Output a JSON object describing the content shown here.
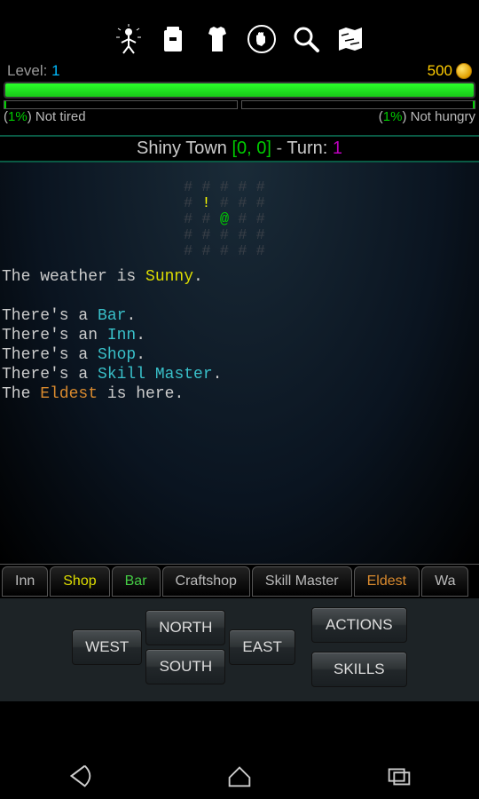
{
  "header": {
    "level_label": "Level:",
    "level_value": "1",
    "gold": "500"
  },
  "bars": {
    "hp_percent": 100,
    "tired_pct": "1%",
    "tired_label": "Not tired",
    "hungry_pct": "1%",
    "hungry_label": "Not hungry"
  },
  "title": {
    "town": "Shiny Town",
    "coord": "[0, 0]",
    "turn_label": "Turn:",
    "turn": "1"
  },
  "map": {
    "rows": [
      "# # # # #",
      "# ! # # #",
      "# # @ # #",
      "# # # # #",
      "# # # # #"
    ]
  },
  "desc": {
    "weather_prefix": "The weather is ",
    "weather_word": "Sunny",
    "lines": [
      {
        "pre": "There's a ",
        "kw": "Bar",
        "cls": "kw-cyan",
        "post": "."
      },
      {
        "pre": "There's an ",
        "kw": "Inn",
        "cls": "kw-cyan",
        "post": "."
      },
      {
        "pre": "There's a ",
        "kw": "Shop",
        "cls": "kw-cyan",
        "post": "."
      },
      {
        "pre": "There's a ",
        "kw": "Skill Master",
        "cls": "kw-cyan",
        "post": "."
      },
      {
        "pre": "The ",
        "kw": "Eldest",
        "cls": "kw-orange",
        "post": " is here."
      }
    ]
  },
  "tabs": [
    {
      "label": "Inn",
      "cls": ""
    },
    {
      "label": "Shop",
      "cls": "yellow"
    },
    {
      "label": "Bar",
      "cls": "green"
    },
    {
      "label": "Craftshop",
      "cls": ""
    },
    {
      "label": "Skill Master",
      "cls": ""
    },
    {
      "label": "Eldest",
      "cls": "orange"
    },
    {
      "label": "Wa",
      "cls": ""
    }
  ],
  "buttons": {
    "north": "NORTH",
    "south": "SOUTH",
    "east": "EAST",
    "west": "WEST",
    "actions": "ACTIONS",
    "skills": "SKILLS"
  }
}
